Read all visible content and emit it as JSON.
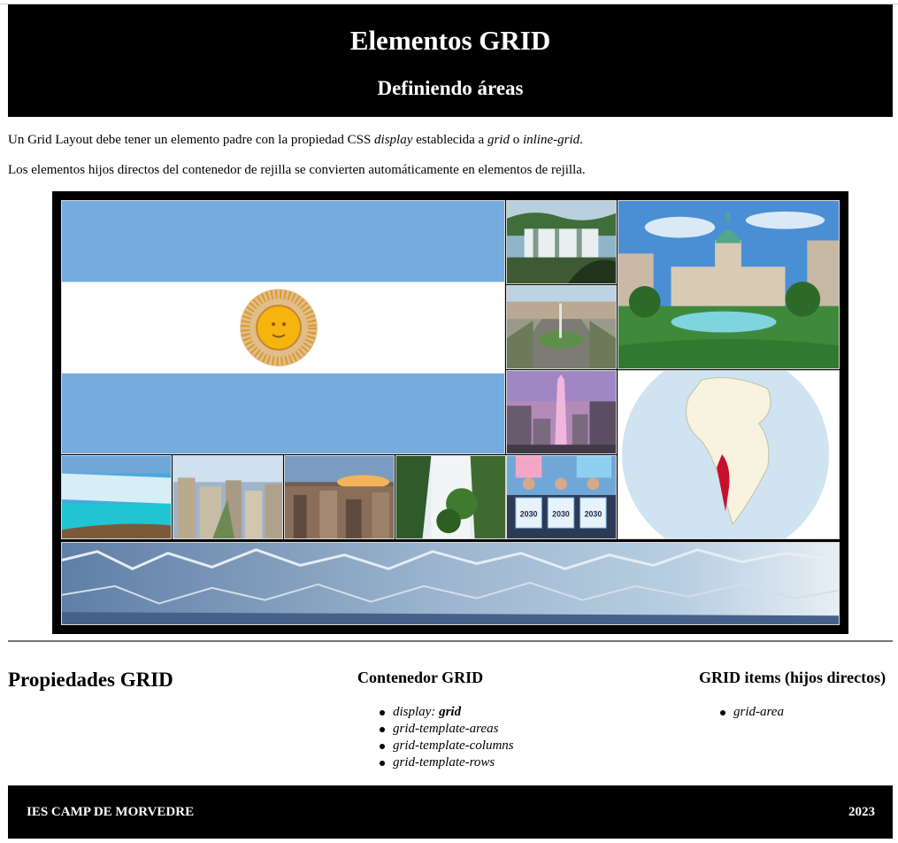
{
  "header": {
    "title": "Elementos GRID",
    "subtitle": "Definiendo áreas"
  },
  "intro": {
    "p1_prefix": "Un Grid Layout debe tener un elemento padre con la propiedad CSS ",
    "p1_display": "display",
    "p1_mid": " establecida a ",
    "p1_grid": "grid",
    "p1_or": " o ",
    "p1_inline": "inline-grid",
    "p1_end": ".",
    "p2": "Los elementos hijos directos del contenedor de rejilla se convierten automáticamente en elementos de rejilla."
  },
  "gallery": {
    "tiles": [
      {
        "name": "argentina-flag-image",
        "subject": "Argentina flag"
      },
      {
        "name": "iguazu-falls-image",
        "subject": "Iguazu falls"
      },
      {
        "name": "congress-building-image",
        "subject": "National Congress"
      },
      {
        "name": "buenos-aires-avenue-image",
        "subject": "Buenos Aires avenue"
      },
      {
        "name": "obelisk-image",
        "subject": "Obelisk"
      },
      {
        "name": "globe-map-image",
        "subject": "Globe with Argentina"
      },
      {
        "name": "glacier-lake-image",
        "subject": "Glacier and lake"
      },
      {
        "name": "city-aerial-image",
        "subject": "City aerial view"
      },
      {
        "name": "sunset-city-image",
        "subject": "City at sunset"
      },
      {
        "name": "waterfall-jungle-image",
        "subject": "Waterfall jungle"
      },
      {
        "name": "football-players-image",
        "subject": "Football players"
      },
      {
        "name": "glacier-wall-image",
        "subject": "Glacier wall"
      }
    ],
    "jersey_text": "2030"
  },
  "properties": {
    "title": "Propiedades GRID",
    "container": {
      "title": "Contenedor GRID",
      "items": [
        {
          "label": "display: ",
          "value": "grid"
        },
        {
          "label": "grid-template-areas",
          "value": ""
        },
        {
          "label": "grid-template-columns",
          "value": ""
        },
        {
          "label": "grid-template-rows",
          "value": ""
        }
      ]
    },
    "items_col": {
      "title": "GRID items (hijos directos)",
      "items": [
        {
          "label": "grid-area"
        }
      ]
    }
  },
  "footer": {
    "left": "IES CAMP DE MORVEDRE",
    "right": "2023"
  },
  "colors": {
    "header_bg": "#000000",
    "flag_blue": "#74acdf",
    "sun": "#f6b40e",
    "footer_bg": "#000000"
  }
}
